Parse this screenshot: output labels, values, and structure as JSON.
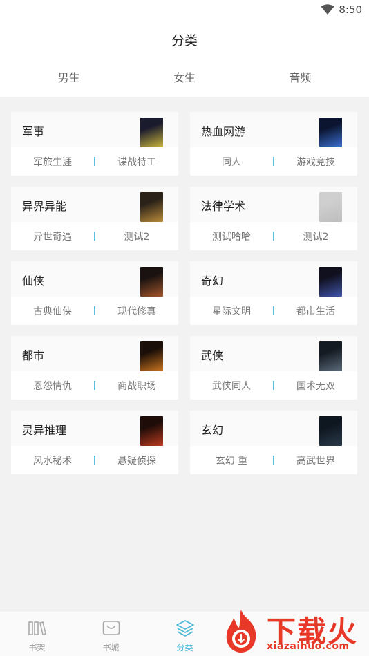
{
  "status": {
    "time": "8:50"
  },
  "header": {
    "title": "分类"
  },
  "tabs": [
    {
      "label": "男生",
      "active": true
    },
    {
      "label": "女生",
      "active": false
    },
    {
      "label": "音频",
      "active": false
    }
  ],
  "categories": [
    {
      "name": "军事",
      "subs": [
        "军旅生涯",
        "谍战特工"
      ],
      "cover_colors": [
        "#1b1b2e",
        "#c9b53a"
      ]
    },
    {
      "name": "热血网游",
      "subs": [
        "同人",
        "游戏竞技"
      ],
      "cover_colors": [
        "#0b1530",
        "#3a6fd1"
      ]
    },
    {
      "name": "异界异能",
      "subs": [
        "异世奇遇",
        "测试2"
      ],
      "cover_colors": [
        "#2a2118",
        "#b98b3a"
      ]
    },
    {
      "name": "法律学术",
      "subs": [
        "测试哈哈",
        "测试2"
      ],
      "cover_colors": [
        "#cfcfcf",
        "#bdbdbd"
      ]
    },
    {
      "name": "仙侠",
      "subs": [
        "古典仙侠",
        "现代修真"
      ],
      "cover_colors": [
        "#1a1210",
        "#a0552a"
      ]
    },
    {
      "name": "奇幻",
      "subs": [
        "星际文明",
        "都市生活"
      ],
      "cover_colors": [
        "#10101e",
        "#4054a8"
      ]
    },
    {
      "name": "都市",
      "subs": [
        "恩怨情仇",
        "商战职场"
      ],
      "cover_colors": [
        "#1a0e08",
        "#c8741e"
      ]
    },
    {
      "name": "武侠",
      "subs": [
        "武侠同人",
        "国术无双"
      ],
      "cover_colors": [
        "#141a22",
        "#5b6a7a"
      ]
    },
    {
      "name": "灵异推理",
      "subs": [
        "风水秘术",
        "悬疑侦探"
      ],
      "cover_colors": [
        "#1e0c08",
        "#b83a1e"
      ]
    },
    {
      "name": "玄幻",
      "subs": [
        "玄幻 重",
        "高武世界"
      ],
      "cover_colors": [
        "#0e1620",
        "#2a3a4a"
      ]
    }
  ],
  "nav": [
    {
      "label": "书架",
      "icon": "bookshelf-icon",
      "active": false
    },
    {
      "label": "书城",
      "icon": "bookstore-icon",
      "active": false
    },
    {
      "label": "分类",
      "icon": "layers-icon",
      "active": true
    }
  ],
  "watermark": {
    "main": "下载火",
    "url": "xiazaihuo.com",
    "color": "#e73828"
  },
  "colors": {
    "accent": "#5ac0dc",
    "background": "#f2f2f2"
  }
}
